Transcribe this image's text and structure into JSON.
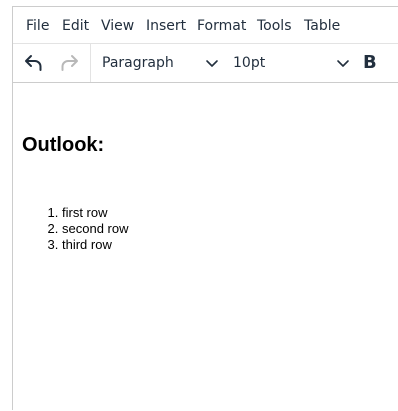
{
  "menubar": {
    "items": [
      "File",
      "Edit",
      "View",
      "Insert",
      "Format",
      "Tools",
      "Table"
    ]
  },
  "toolbar": {
    "undo_icon": "undo-icon",
    "redo_icon": "redo-icon",
    "block_format": "Paragraph",
    "font_size": "10pt",
    "bold_label": "B"
  },
  "document": {
    "heading": "Outlook:",
    "list_items": [
      "first row",
      "second row",
      "third row"
    ]
  },
  "colors": {
    "text": "#222f3e",
    "redo_disabled": "#b8b8b8",
    "border": "#cccccc"
  }
}
